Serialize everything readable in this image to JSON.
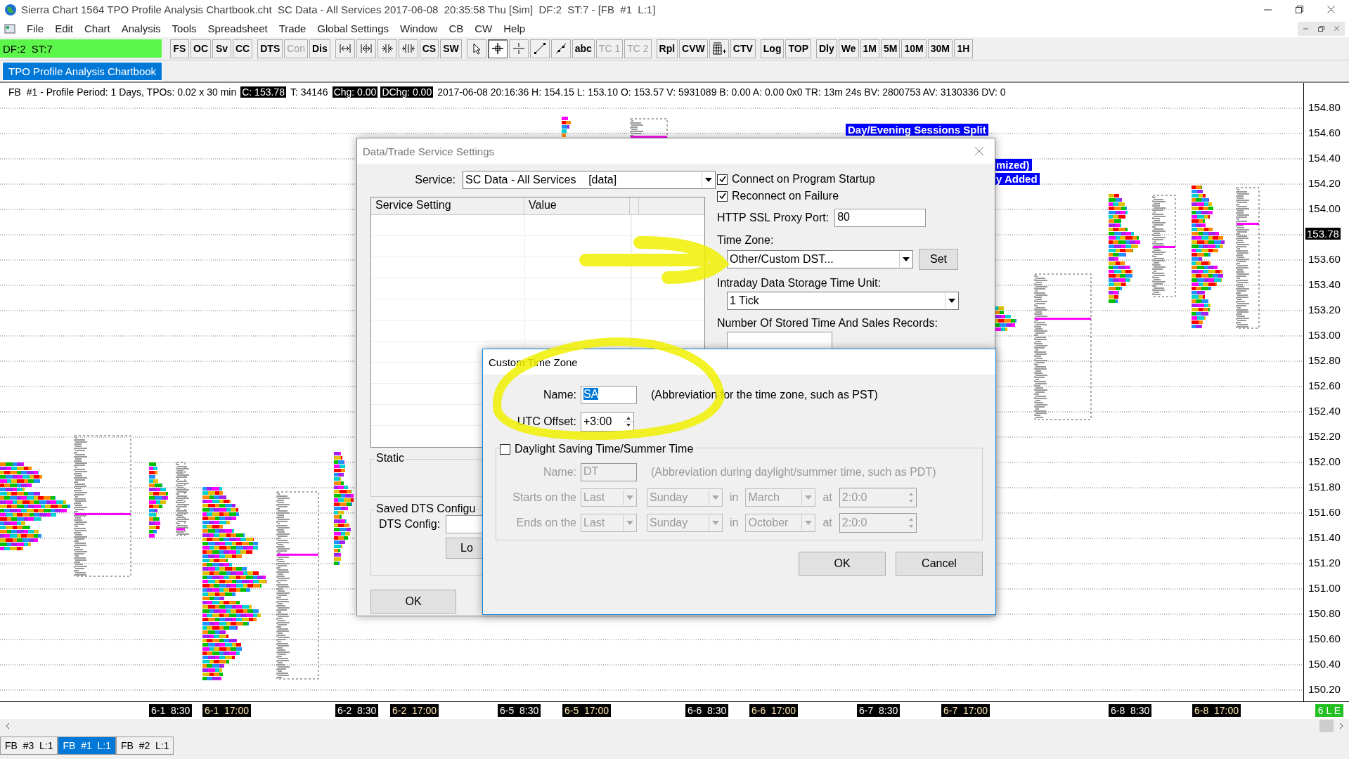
{
  "window": {
    "title": "Sierra Chart 1564 TPO Profile Analysis Chartbook.cht  SC Data - All Services 2017-06-08  20:35:58 Thu [Sim]  DF:2  ST:7 - [FB  #1  L:1]"
  },
  "menu": [
    "File",
    "Edit",
    "Chart",
    "Analysis",
    "Tools",
    "Spreadsheet",
    "Trade",
    "Global Settings",
    "Window",
    "CB",
    "CW",
    "Help"
  ],
  "status_cell": "DF:2  ST:7",
  "toolbar_groups": [
    {
      "buttons": [
        {
          "kind": "text",
          "label": "FS",
          "disabled": false,
          "selected": false
        },
        {
          "kind": "text",
          "label": "OC",
          "disabled": false,
          "selected": false
        },
        {
          "kind": "text",
          "label": "Sv",
          "disabled": false,
          "selected": false
        },
        {
          "kind": "text",
          "label": "CC",
          "disabled": false,
          "selected": false
        }
      ]
    },
    {
      "buttons": [
        {
          "kind": "text",
          "label": "DTS",
          "disabled": false,
          "selected": false
        },
        {
          "kind": "text",
          "label": "Con",
          "disabled": true,
          "selected": false
        },
        {
          "kind": "text",
          "label": "Dis",
          "disabled": false,
          "selected": false
        }
      ]
    },
    {
      "buttons": [
        {
          "kind": "icon",
          "disabled": false,
          "selected": false
        },
        {
          "kind": "icon",
          "disabled": false,
          "selected": false
        },
        {
          "kind": "icon",
          "disabled": false,
          "selected": false
        },
        {
          "kind": "icon",
          "disabled": false,
          "selected": false
        },
        {
          "kind": "text",
          "label": "CS",
          "disabled": false,
          "selected": false
        },
        {
          "kind": "text",
          "label": "SW",
          "disabled": false,
          "selected": false
        }
      ]
    },
    {
      "buttons": [
        {
          "kind": "icon",
          "disabled": false,
          "selected": false
        },
        {
          "kind": "icon",
          "disabled": false,
          "selected": true
        },
        {
          "kind": "icon",
          "disabled": false,
          "selected": false
        },
        {
          "kind": "icon",
          "disabled": false,
          "selected": false
        },
        {
          "kind": "icon",
          "disabled": false,
          "selected": false
        },
        {
          "kind": "text",
          "label": "abc",
          "disabled": false,
          "selected": false
        },
        {
          "kind": "text",
          "label": "TC 1",
          "disabled": true,
          "selected": false
        },
        {
          "kind": "text",
          "label": "TC 2",
          "disabled": true,
          "selected": false
        }
      ]
    },
    {
      "buttons": [
        {
          "kind": "text",
          "label": "Rpl",
          "disabled": false,
          "selected": false
        },
        {
          "kind": "text",
          "label": "CVW",
          "disabled": false,
          "selected": false
        },
        {
          "kind": "icon",
          "disabled": false,
          "selected": false
        },
        {
          "kind": "text",
          "label": "CTV",
          "disabled": false,
          "selected": false
        }
      ]
    },
    {
      "buttons": [
        {
          "kind": "text",
          "label": "Log",
          "disabled": false,
          "selected": false
        },
        {
          "kind": "text",
          "label": "TOP",
          "disabled": false,
          "selected": false
        }
      ]
    },
    {
      "buttons": [
        {
          "kind": "text",
          "label": "Dly",
          "disabled": false,
          "selected": false
        },
        {
          "kind": "text",
          "label": "We",
          "disabled": false,
          "selected": false
        },
        {
          "kind": "text",
          "label": "1M",
          "disabled": false,
          "selected": false
        },
        {
          "kind": "text",
          "label": "5M",
          "disabled": false,
          "selected": false
        },
        {
          "kind": "text",
          "label": "10M",
          "disabled": false,
          "selected": false
        },
        {
          "kind": "text",
          "label": "30M",
          "disabled": false,
          "selected": false
        },
        {
          "kind": "text",
          "label": "1H",
          "disabled": false,
          "selected": false
        }
      ]
    }
  ],
  "chartbook_tab": "TPO Profile Analysis Chartbook",
  "info_line": [
    {
      "text": "FB  #1 - Profile Period: 1 Days, TPOs: 0.02 x 30 min",
      "highlighted": false
    },
    {
      "text": "C: 153.78",
      "highlighted": true
    },
    {
      "text": "T: 34146",
      "highlighted": false
    },
    {
      "text": "Chg: 0.00",
      "highlighted": true
    },
    {
      "text": "DChg: 0.00",
      "highlighted": true
    },
    {
      "text": "2017-06-08 20:16:36 H: 154.15 L: 153.10 O: 153.57 V: 5931089 B: 0.00 A: 0.00 0x0 TR: 13m 24s BV: 2800753 AV: 3130336 DV: 0",
      "highlighted": false
    }
  ],
  "chart": {
    "labels": [
      "Day/Evening Sessions Split",
      "mized)",
      "y Added"
    ],
    "price_axis": [
      {
        "label": "154.80",
        "kind": "tick"
      },
      {
        "label": "154.60",
        "kind": "tick"
      },
      {
        "label": "154.40",
        "kind": "tick"
      },
      {
        "label": "154.20",
        "kind": "tick"
      },
      {
        "label": "154.00",
        "kind": "tick"
      },
      {
        "label": "153.78",
        "kind": "current"
      },
      {
        "label": "153.60",
        "kind": "tick"
      },
      {
        "label": "153.40",
        "kind": "tick"
      },
      {
        "label": "153.20",
        "kind": "tick"
      },
      {
        "label": "153.00",
        "kind": "tick"
      },
      {
        "label": "152.80",
        "kind": "tick"
      },
      {
        "label": "152.60",
        "kind": "tick"
      },
      {
        "label": "152.40",
        "kind": "tick"
      },
      {
        "label": "152.20",
        "kind": "tick"
      },
      {
        "label": "152.00",
        "kind": "tick"
      },
      {
        "label": "151.80",
        "kind": "tick"
      },
      {
        "label": "151.60",
        "kind": "tick"
      },
      {
        "label": "151.40",
        "kind": "tick"
      },
      {
        "label": "151.20",
        "kind": "tick"
      },
      {
        "label": "151.00",
        "kind": "tick"
      },
      {
        "label": "150.80",
        "kind": "tick"
      },
      {
        "label": "150.60",
        "kind": "tick"
      },
      {
        "label": "150.40",
        "kind": "tick"
      },
      {
        "label": "150.20",
        "kind": "tick"
      }
    ],
    "time_axis": [
      "6-1  8:30",
      "6-1  17:00",
      "6-2  8:30",
      "6-2  17:00",
      "6-5  8:30",
      "6-5  17:00",
      "6-6  8:30",
      "6-6  17:00",
      "6-7  8:30",
      "6-7  17:00",
      "6-8  8:30",
      "6-8  17:00"
    ],
    "status_badge": "6 L E"
  },
  "data_trade_dialog": {
    "title": "Data/Trade Service Settings",
    "service_label": "Service:",
    "service_value": "SC Data - All Services    [data]",
    "table_columns": [
      "Service Setting",
      "Value"
    ],
    "checkboxes": [
      {
        "label": "Connect on Program Startup",
        "checked": true
      },
      {
        "label": "Reconnect on Failure",
        "checked": true
      }
    ],
    "proxy_label": "HTTP SSL Proxy Port:",
    "proxy_value": "80",
    "time_zone_label": "Time Zone:",
    "time_zone_value": "Other/Custom DST...",
    "set_button": "Set",
    "storage_label": "Intraday Data Storage Time Unit:",
    "storage_value": "1 Tick",
    "records_label": "Number Of Stored Time And Sales Records:",
    "static_group": "Static",
    "saved_group": "Saved DTS Configu",
    "dts_config_label": "DTS Config:",
    "load_button": "Lo",
    "ok_button": "OK"
  },
  "custom_time_zone_dialog": {
    "title": "Custom Time Zone",
    "name_label": "Name:",
    "name_value": "SA",
    "name_text_selected": true,
    "name_hint": "(Abbreviation for the time zone, such as PST)",
    "offset_label": "UTC Offset:",
    "offset_value": "+3:00",
    "daylight_saving": {
      "label": "Daylight Saving Time/Summer Time",
      "checked": false
    },
    "dst_name_label": "Name:",
    "dst_name_value": "DT",
    "dst_name_hint": "(Abbreviation during daylight/summer time, such as PDT)",
    "rules": [
      {
        "label": "Starts on the",
        "week": "Last",
        "day": "Sunday",
        "in_label": "in",
        "month": "March",
        "at_label": "at",
        "time": "2:0:0"
      },
      {
        "label": "Ends on the",
        "week": "Last",
        "day": "Sunday",
        "in_label": "in",
        "month": "October",
        "at_label": "at",
        "time": "2:0:0"
      }
    ],
    "ok_button": "OK",
    "cancel_button": "Cancel"
  },
  "chart_tabs": [
    {
      "label": "FB  #3  L:1",
      "selected": false
    },
    {
      "label": "FB  #1  L:1",
      "selected": true
    },
    {
      "label": "FB  #2  L:1",
      "selected": false
    }
  ]
}
